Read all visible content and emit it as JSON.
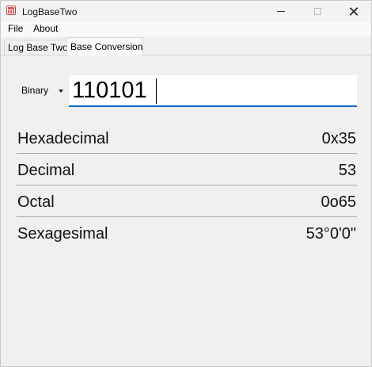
{
  "window": {
    "title": "LogBaseTwo"
  },
  "menu": {
    "file": "File",
    "about": "About"
  },
  "tabs": {
    "log_base_two": "Log Base Two",
    "base_conversion": "Base Conversion"
  },
  "converter": {
    "base_selected": "Binary",
    "input_value": "110101"
  },
  "results": [
    {
      "label": "Hexadecimal",
      "value": "0x35"
    },
    {
      "label": "Decimal",
      "value": "53"
    },
    {
      "label": "Octal",
      "value": "0o65"
    },
    {
      "label": "Sexagesimal",
      "value": "53°0'0\""
    }
  ]
}
